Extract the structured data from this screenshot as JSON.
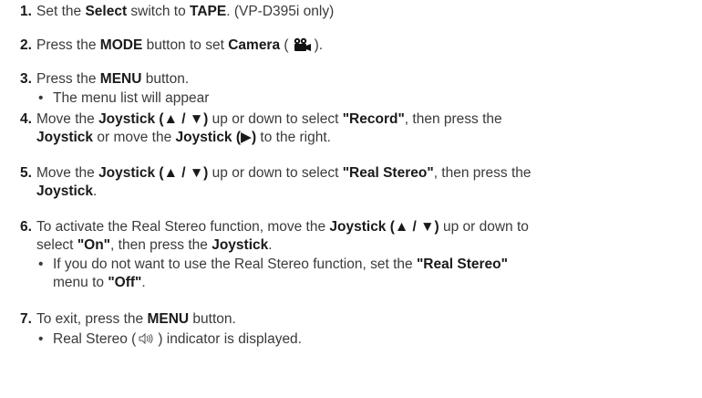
{
  "steps": [
    {
      "num": "1.",
      "a": "Set the ",
      "b1": "Select",
      "c": " switch to ",
      "b2": "TAPE",
      "d": ". (VP-D395i only)"
    },
    {
      "num": "2.",
      "a": "Press the ",
      "b1": "MODE",
      "c": " button to set ",
      "b2": "Camera",
      "d1": " (",
      "d2": ")."
    },
    {
      "num": "3.",
      "a": "Press the ",
      "b1": "MENU",
      "c": " button."
    },
    {
      "num": "4.",
      "a": "Move the ",
      "b1": "Joystick (▲ / ▼)",
      "c": " up or down to select ",
      "b2": "\"Record\"",
      "d": ", then press the",
      "e_b": "Joystick",
      "f": " or move the ",
      "g_b": "Joystick (▶)",
      "h": " to the right."
    },
    {
      "num": "5.",
      "a": "Move the ",
      "b1": "Joystick (▲ / ▼)",
      "c": " up or down to select ",
      "b2": "\"Real Stereo\"",
      "d": ", then press the",
      "e_b": "Joystick",
      "f": "."
    },
    {
      "num": "6.",
      "a": "To activate the Real Stereo function, move the ",
      "b1": "Joystick (▲ / ▼)",
      "c": " up or down to",
      "d": "select ",
      "b2": "\"On\"",
      "e": ", then press the ",
      "f_b": "Joystick",
      "g": "."
    },
    {
      "num": "7.",
      "a": "To exit, press the ",
      "b1": "MENU",
      "c": " button."
    }
  ],
  "bullets": {
    "step3": "The menu list will appear",
    "step6_a": "If you do not want to use the Real Stereo function, set the ",
    "step6_b": "\"Real Stereo\"",
    "step6_c": "menu to ",
    "step6_d": "\"Off\"",
    "step6_e": ".",
    "step7_a": "Real Stereo (",
    "step7_b": ") indicator is displayed."
  },
  "bullet_glyph": "•",
  "icons": {
    "camera": "camcorder-icon",
    "stereo": "real-stereo-icon"
  }
}
